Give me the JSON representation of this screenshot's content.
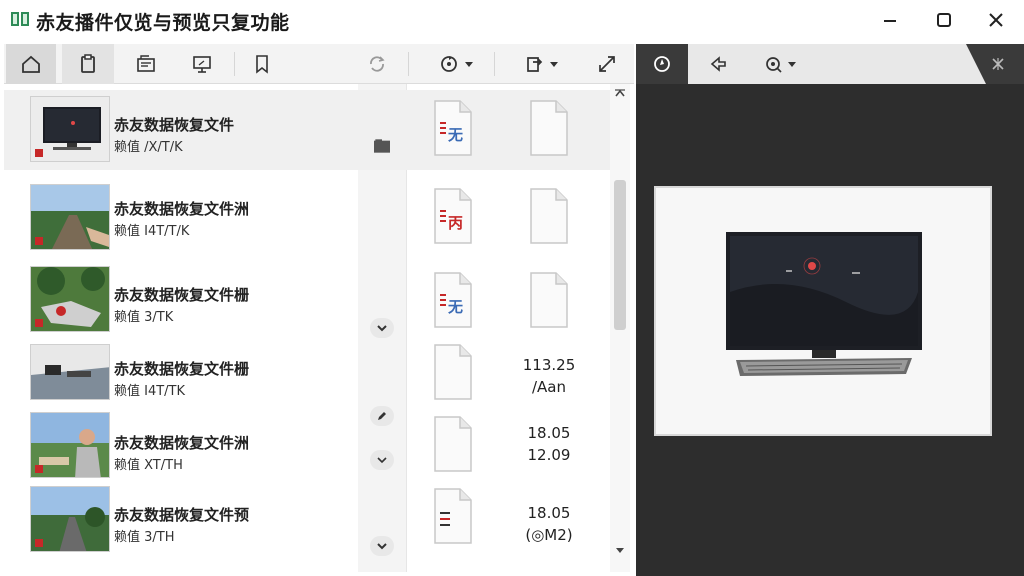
{
  "window": {
    "title": "赤友播件仅览与预览只复功能"
  },
  "toolbar": {
    "buttons": [
      {
        "name": "home-button",
        "icon": "home-icon"
      },
      {
        "name": "clipboard-button",
        "icon": "clipboard-icon"
      },
      {
        "name": "folder-view-button",
        "icon": "folder-view-icon"
      },
      {
        "name": "screen-button",
        "icon": "screen-icon"
      },
      {
        "name": "bookmark-button",
        "icon": "bookmark-icon"
      },
      {
        "name": "refresh-button",
        "icon": "refresh-icon"
      },
      {
        "name": "recover-dropdown-button",
        "icon": "recover-icon"
      },
      {
        "name": "export-dropdown-button",
        "icon": "export-icon"
      },
      {
        "name": "expand-button",
        "icon": "expand-icon"
      }
    ]
  },
  "files": [
    {
      "name": "赤友数据恢复文件",
      "sub": "赖值 /X/T/K",
      "thumb": "monitor",
      "doc": "text",
      "doc_text": "无",
      "meta": [
        "",
        ""
      ],
      "mini": "folder-icon",
      "selected": true
    },
    {
      "name": "赤友数据恢复文件洲",
      "sub": "赖值 I4T/T/K",
      "thumb": "road",
      "doc": "text",
      "doc_text": "丙",
      "meta": [
        "",
        ""
      ],
      "mini": "",
      "selected": false
    },
    {
      "name": "赤友数据恢复文件栅",
      "sub": "赖值 3/TK",
      "thumb": "garden",
      "doc": "text",
      "doc_text": "无",
      "meta": [
        "",
        ""
      ],
      "mini": "chevron-down-icon",
      "selected": false
    },
    {
      "name": "赤友数据恢复文件栅",
      "sub": "赖值 I4T/TK",
      "thumb": "desk",
      "doc": "blank",
      "doc_text": "",
      "meta": [
        "113.25",
        "/Aan"
      ],
      "mini": "",
      "selected": false
    },
    {
      "name": "赤友数据恢复文件洲",
      "sub": "赖值 XT/TH",
      "thumb": "person",
      "doc": "blank",
      "doc_text": "",
      "meta": [
        "18.05",
        "12.09"
      ],
      "mini": "pen-icon",
      "selected": false
    },
    {
      "name": "赤友数据恢复文件预",
      "sub": "赖值 3/TH",
      "thumb": "highway",
      "doc": "lines",
      "doc_text": "",
      "meta": [
        "18.05",
        "(◎M2)"
      ],
      "mini": "chevron-down-icon",
      "selected": false
    }
  ],
  "preview": {
    "tools": [
      "info-icon",
      "share-icon",
      "view-options-icon"
    ],
    "image": "monitor-keyboard"
  },
  "colors": {
    "accent_red": "#c62828",
    "doc_blue": "#3b6bb5",
    "preview_bg": "#2d2d2d"
  }
}
